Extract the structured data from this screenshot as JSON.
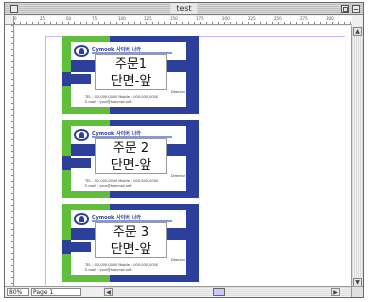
{
  "window": {
    "title": "test"
  },
  "ruler": {
    "ticks": [
      "0",
      "25",
      "50",
      "75",
      "100",
      "125",
      "150",
      "175",
      "200",
      "225",
      "250",
      "275",
      "300"
    ]
  },
  "status": {
    "zoom": "80%",
    "page": "Page 1"
  },
  "cards": [
    {
      "line1": "주문1",
      "line2": "단면-앞",
      "company": "Cymook 사이버 나라",
      "tel": "TEL : 02-000-0000  Mobile : 000-000-0000",
      "email": "E-mail : your@hanmail.net",
      "name": "Director"
    },
    {
      "line1": "주문 2",
      "line2": "단면-앞",
      "company": "Cymook 사이버 나라",
      "tel": "TEL : 02-000-0000  Mobile : 000-000-0000",
      "email": "E-mail : your@hanmail.net",
      "name": "Director"
    },
    {
      "line1": "주문 3",
      "line2": "단면-앞",
      "company": "Cymook 사이버 나라",
      "tel": "TEL : 02-000-0000  Mobile : 000-000-0000",
      "email": "E-mail : your@hanmail.net",
      "name": "Director"
    }
  ],
  "colors": {
    "card_blue": "#2c3f9b",
    "card_green": "#5fbf3a"
  }
}
